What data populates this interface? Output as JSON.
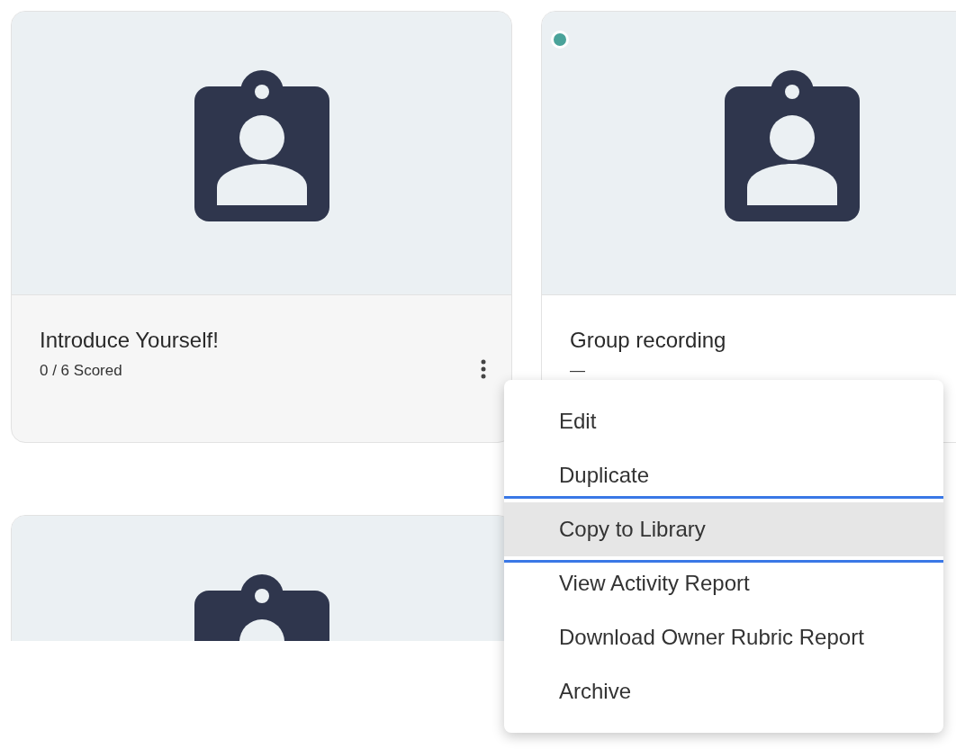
{
  "cards": [
    {
      "title": "Introduce Yourself!",
      "subtitle": "0 / 6 Scored",
      "highlighted": true
    },
    {
      "title": "Group recording",
      "subtitle": "—",
      "highlighted": false,
      "color": "#4aa39a"
    },
    {
      "highlighted": false
    }
  ],
  "menu": [
    {
      "label": "Edit",
      "selected": false
    },
    {
      "label": "Duplicate",
      "selected": false
    },
    {
      "label": "Copy to Library",
      "selected": true
    },
    {
      "label": "View Activity Report",
      "selected": false
    },
    {
      "label": "Download Owner Rubric Report",
      "selected": false
    },
    {
      "label": "Archive",
      "selected": false
    }
  ]
}
